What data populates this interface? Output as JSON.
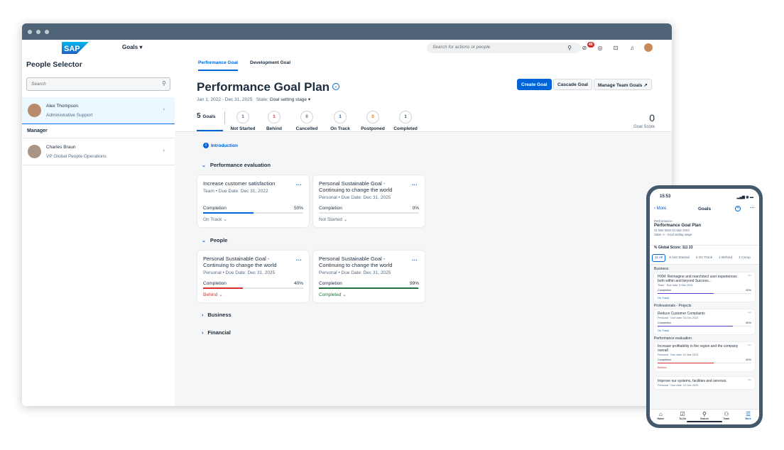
{
  "shell": {
    "logo": "SAP",
    "nav_label": "Goals",
    "search_placeholder": "Search for actions or people",
    "notification_count": "40"
  },
  "people_selector": {
    "title": "People Selector",
    "search_placeholder": "Search",
    "selected": {
      "name": "Alex Thompson",
      "role": "Administrative Support"
    },
    "manager_label": "Manager",
    "manager": {
      "name": "Charles Braun",
      "role": "VP Global People Operations"
    }
  },
  "tabs": [
    "Performance Goal",
    "Development Goal"
  ],
  "plan": {
    "title": "Performance Goal Plan",
    "dates": "Jan 1, 2022 - Dec 31, 2025",
    "state_label": "State:",
    "state": "Goal setting stage",
    "buttons": {
      "create": "Create Goal",
      "cascade": "Cascade Goal",
      "manage": "Manage Team Goals"
    },
    "goals_count": "5",
    "goals_label": "Goals",
    "stats": [
      {
        "count": "1",
        "label": "Not Started",
        "color": "#556b82"
      },
      {
        "count": "1",
        "label": "Behind",
        "color": "#d9364c"
      },
      {
        "count": "0",
        "label": "Cancelled",
        "color": "#556b82"
      },
      {
        "count": "1",
        "label": "On Track",
        "color": "#0064d9"
      },
      {
        "count": "0",
        "label": "Postponed",
        "color": "#e9730c"
      },
      {
        "count": "1",
        "label": "Completed",
        "color": "#256f3a"
      }
    ],
    "goal_score": "0",
    "goal_score_label": "Goal Score"
  },
  "intro": "Introduction",
  "sections": {
    "performance": "Performance evaluation",
    "people": "People",
    "business": "Business",
    "financial": "Financial"
  },
  "cards": [
    {
      "title": "Increase customer satisfaction",
      "sub": "Team • Due Date: Dec 31, 2022",
      "completion_label": "Completion",
      "percent": "50%",
      "progress": 0.5,
      "status": "On Track",
      "color": "#0064d9",
      "status_color": "#556b82"
    },
    {
      "title": "Personal Sustainable Goal - Continuing to change the world",
      "sub": "Personal • Due Date: Dec 31, 2025",
      "completion_label": "Completion",
      "percent": "0%",
      "progress": 0,
      "status": "Not Started",
      "color": "#556b82",
      "status_color": "#556b82"
    },
    {
      "title": "Personal Sustainable Goal - Continuing to change the world",
      "sub": "Personal • Due Date: Dec 31, 2025",
      "completion_label": "Completion",
      "percent": "40%",
      "progress": 0.4,
      "status": "Behind",
      "color": "#d32f2f",
      "status_color": "#d32f2f"
    },
    {
      "title": "Personal Sustainable Goal - Continuing to change the world",
      "sub": "Personal • Due Date: Dec 31, 2025",
      "completion_label": "Completion",
      "percent": "99%",
      "progress": 0.99,
      "status": "Completed",
      "color": "#256f3a",
      "status_color": "#256f3a"
    }
  ],
  "phone": {
    "time": "15:53",
    "back": "More",
    "title": "Goals",
    "header_a": "Performance",
    "header_b": "Performance Goal Plan",
    "header_c": "31 Mar 2022-31 Mar 2023",
    "header_d": "State: A - Goal setting stage",
    "score": "% Global Score: 111 33",
    "tabs": [
      "11 All",
      "6 Not Started",
      "3 On Track",
      "1 Behind",
      "1 Comp"
    ],
    "groups": [
      {
        "section": "Business",
        "title": "HXM: Reimagine and rearchitect user experiences both within and beyond Success...",
        "sub": "Team · Due date: 5 Mar 2023",
        "label": "Completion",
        "percent": "60%",
        "progress": 0.6,
        "status": "On Track",
        "color": "#5b3fd1",
        "status_color": "#0064d9"
      },
      {
        "section": "Professionals - Projects",
        "title": "Reduce Customer Complaints",
        "sub": "Personal · Due date: 31 Dec 2022",
        "label": "Completion",
        "percent": "80%",
        "progress": 0.8,
        "status": "On Track",
        "color": "#5b3fd1",
        "status_color": "#0064d9"
      },
      {
        "section": "Performance evaluation",
        "title": "Increase profitability in the region and the company overall",
        "sub": "Personal · Due date: 31 Mar 2023",
        "label": "Completion",
        "percent": "60%",
        "progress": 0.6,
        "status": "Behind",
        "color": "#d32f2f",
        "status_color": "#d32f2f"
      }
    ],
    "last_title": "Improve our systems, facilities and services.",
    "last_sub": "Personal · Due date: 31 Dec 2023",
    "nav": [
      "Home",
      "To-Do",
      "Search",
      "Team",
      "More"
    ]
  }
}
